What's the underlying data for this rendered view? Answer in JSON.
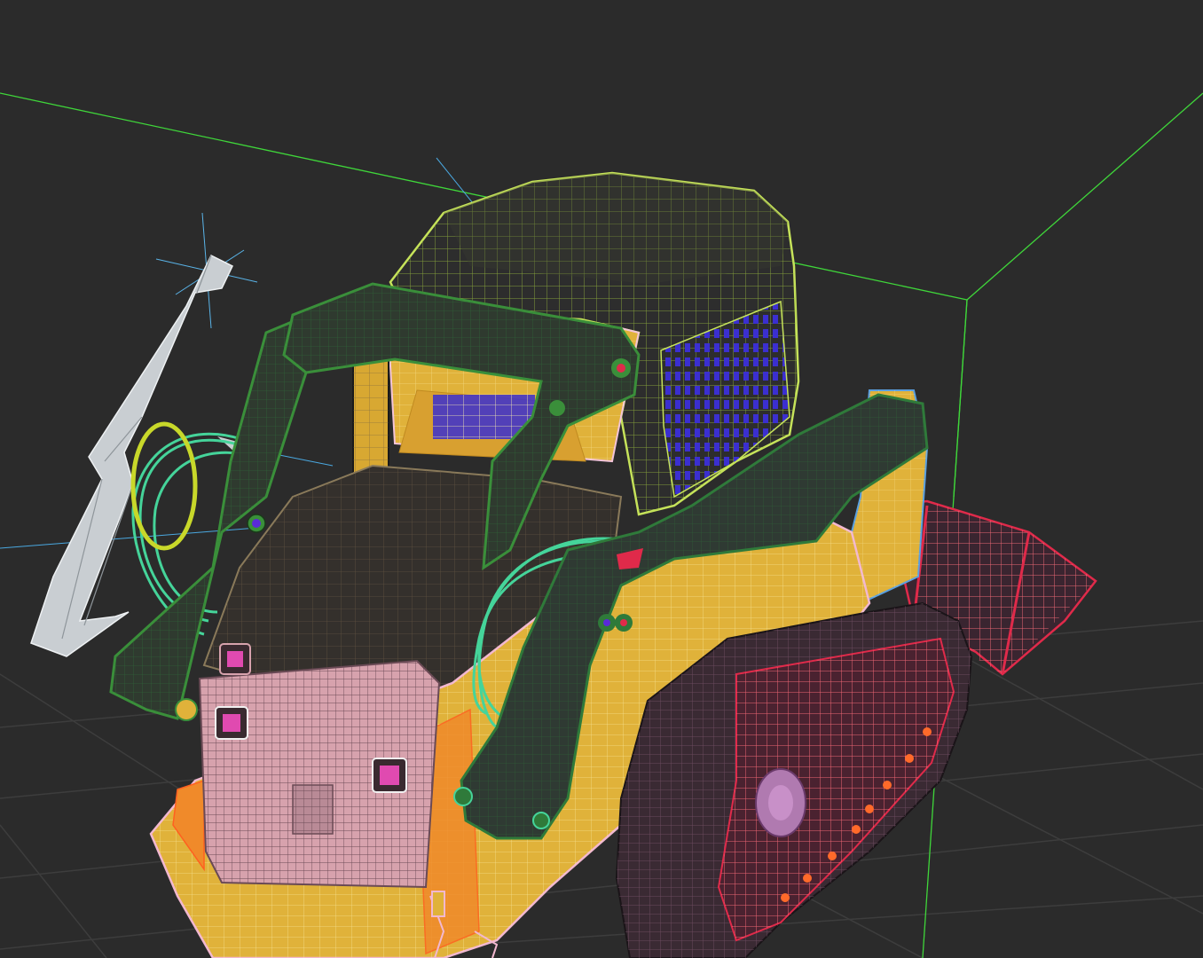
{
  "viewport": {
    "background": "#2b2b2b",
    "grid_color": "#3d3d3d",
    "selection_box_color": "#3fd63a",
    "gizmo_color": "#4aa8e0"
  },
  "model": {
    "cab_wire_color": "#c6e35a",
    "body_fill": "#e0b23a",
    "frame_wire_color": "#3a8f3a",
    "hose_color": "#45d49a",
    "track_color": "#3a2a33",
    "bucket_color": "#e02a4a",
    "rear_panel_color": "#d7a2ad",
    "light_marker_color": "#e04ab0",
    "mesh_grid_color": "#4a3cd8"
  },
  "light": {
    "color": "#cfd4d8"
  }
}
